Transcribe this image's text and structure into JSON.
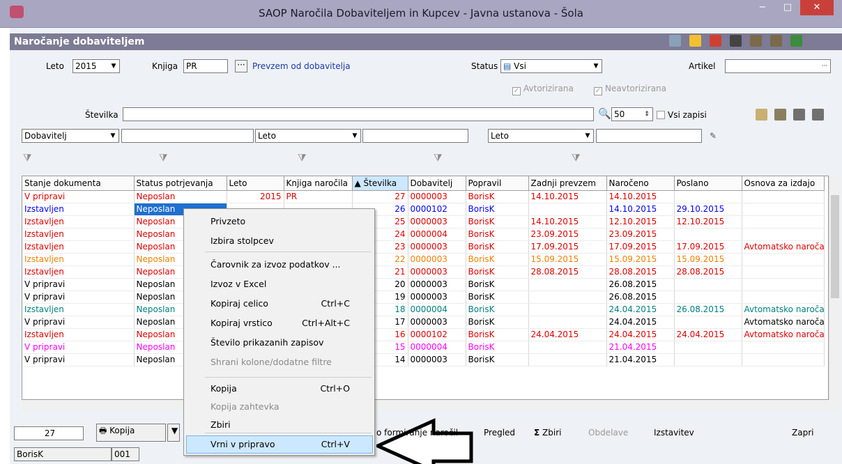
{
  "window": {
    "title": "SAOP  Naročila Dobaviteljem in Kupcev - Javna ustanova - Šola",
    "min": "−",
    "max": "□",
    "close": "✕"
  },
  "subheader": "Naročanje dobaviteljem",
  "filters": {
    "leto_label": "Leto",
    "leto_value": "2015",
    "knjiga_label": "Knjiga",
    "knjiga_value": "PR",
    "knjiga_desc": "Prevzem od dobavitelja",
    "status_label": "Status",
    "status_value": "Vsi",
    "artikel_label": "Artikel",
    "avtorizirana": "Avtorizirana",
    "neavtorizirana": "Neavtorizirana",
    "stevilka_label": "Številka",
    "count_value": "50",
    "vsi_zapisi": "Vsi zapisi",
    "col1": "Dobavitelj",
    "col2": "Leto",
    "col3": "Leto",
    "ellipsis": "···"
  },
  "table": {
    "headers": [
      "Stanje dokumenta",
      "Status potrjevanja",
      "Leto",
      "Knjiga naročila",
      "▲ Številka",
      "Dobavitelj",
      "Popravil",
      "Zadnji prevzem",
      "Naročeno",
      "Poslano",
      "Osnova za izdajo"
    ],
    "rows": [
      [
        "V pripravi",
        "Neposlan",
        "2015",
        "PR",
        "27",
        "0000003",
        "BorisK",
        "14.10.2015",
        "14.10.2015",
        "",
        ""
      ],
      [
        "Izstavljen",
        "Neposlan",
        "",
        "",
        "26",
        "0000102",
        "BorisK",
        "",
        "14.10.2015",
        "29.10.2015",
        ""
      ],
      [
        "Izstavljen",
        "Neposlan",
        "",
        "",
        "25",
        "0000003",
        "BorisK",
        "14.10.2015",
        "12.10.2015",
        "12.10.2015",
        ""
      ],
      [
        "Izstavljen",
        "Neposlan",
        "",
        "",
        "24",
        "0000004",
        "BorisK",
        "23.09.2015",
        "23.09.2015",
        "",
        ""
      ],
      [
        "Izstavljen",
        "Neposlan",
        "",
        "",
        "23",
        "0000003",
        "BorisK",
        "17.09.2015",
        "17.09.2015",
        "17.09.2015",
        "Avtomatsko naročan"
      ],
      [
        "Izstavljen",
        "Neposlan",
        "",
        "",
        "22",
        "0000003",
        "BorisK",
        "15.09.2015",
        "15.09.2015",
        "15.09.2015",
        ""
      ],
      [
        "Izstavljen",
        "Neposlan",
        "",
        "",
        "21",
        "0000003",
        "BorisK",
        "28.08.2015",
        "28.08.2015",
        "28.08.2015",
        ""
      ],
      [
        "V pripravi",
        "Neposlan",
        "",
        "",
        "20",
        "0000003",
        "BorisK",
        "",
        "26.08.2015",
        "",
        ""
      ],
      [
        "V pripravi",
        "Neposlan",
        "",
        "",
        "19",
        "0000003",
        "BorisK",
        "",
        "26.08.2015",
        "",
        ""
      ],
      [
        "Izstavljen",
        "Neposlan",
        "",
        "",
        "18",
        "0000004",
        "BorisK",
        "",
        "24.04.2015",
        "26.08.2015",
        "Avtomatsko naročan"
      ],
      [
        "V pripravi",
        "Neposlan",
        "",
        "",
        "17",
        "0000003",
        "BorisK",
        "",
        "24.04.2015",
        "",
        "Avtomatsko naročan"
      ],
      [
        "Izstavljen",
        "Neposlan",
        "",
        "",
        "16",
        "0000102",
        "BorisK",
        "24.04.2015",
        "24.04.2015",
        "24.04.2015",
        "Avtomatsko naročan"
      ],
      [
        "V pripravi",
        "Neposlan",
        "",
        "",
        "15",
        "0000004",
        "BorisK",
        "",
        "21.04.2015",
        "",
        ""
      ],
      [
        "V pripravi",
        "Neposlan",
        "",
        "",
        "14",
        "0000003",
        "BorisK",
        "",
        "21.04.2015",
        "",
        ""
      ]
    ],
    "row_colors": [
      "#e00000",
      "#0000ff",
      "#e00000",
      "#e00000",
      "#e00000",
      "#f08000",
      "#e00000",
      "#000000",
      "#000000",
      "#008080",
      "#000000",
      "#e00000",
      "#ff00ff",
      "#000000"
    ]
  },
  "context_menu": {
    "items": [
      {
        "label": "Privzeto",
        "shortcut": "",
        "enabled": true
      },
      {
        "label": "Izbira stolpcev",
        "shortcut": "",
        "enabled": true
      },
      {
        "label": "Čarovnik za izvoz podatkov ...",
        "shortcut": "",
        "enabled": true
      },
      {
        "label": "Izvoz v Excel",
        "shortcut": "",
        "enabled": true
      },
      {
        "label": "Kopiraj celico",
        "shortcut": "Ctrl+C",
        "enabled": true
      },
      {
        "label": "Kopiraj vrstico",
        "shortcut": "Ctrl+Alt+C",
        "enabled": true
      },
      {
        "label": "Število prikazanih zapisov",
        "shortcut": "",
        "enabled": true
      },
      {
        "label": "Shrani kolone/dodatne filtre",
        "shortcut": "",
        "enabled": false
      },
      {
        "label": "Kopija",
        "shortcut": "Ctrl+O",
        "enabled": true
      },
      {
        "label": "Kopija zahtevka",
        "shortcut": "",
        "enabled": false
      },
      {
        "label": "Zbiri",
        "shortcut": "",
        "enabled": true
      },
      {
        "label": "Vrni v pripravo",
        "shortcut": "Ctrl+V",
        "enabled": true
      }
    ]
  },
  "bottom": {
    "count": "27",
    "kopija": "Kopija",
    "formiranje": "o formiranje naročil",
    "pregled": "Pregled",
    "zbiri": "Zbiri",
    "obdelave": "Obdelave",
    "izstavitev": "Izstavitev",
    "zapri": "Zapri",
    "user": "BorisK",
    "code": "001"
  }
}
